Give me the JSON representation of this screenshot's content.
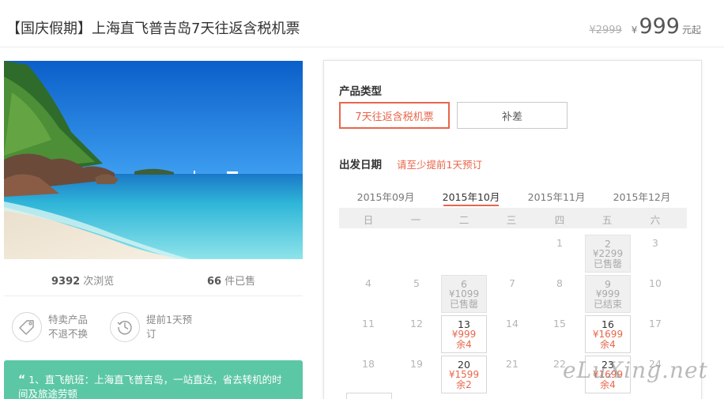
{
  "header": {
    "title": "【国庆假期】上海直飞普吉岛7天往返含税机票",
    "old_price": "¥2999",
    "currency": "¥",
    "price": "999",
    "price_suffix": "元起"
  },
  "stats": {
    "views_num": "9392",
    "views_label": "次浏览",
    "sold_num": "66",
    "sold_label": "件已售"
  },
  "features": [
    {
      "icon": "tag-icon",
      "text": "特卖产品 不退不换"
    },
    {
      "icon": "clock-icon",
      "text": "提前1天预订"
    }
  ],
  "description": {
    "quote": "“",
    "text": "1、直飞航班：上海直飞普吉岛，一站直达，省去转机的时间及旅途劳顿"
  },
  "panel": {
    "type_label": "产品类型",
    "types": [
      "7天往返含税机票",
      "补差"
    ],
    "date_label": "出发日期",
    "date_tip": "请至少提前1天预订",
    "months": [
      "2015年09月",
      "2015年10月",
      "2015年11月",
      "2015年12月"
    ],
    "active_month": "2015年10月",
    "weekdays": [
      "日",
      "一",
      "二",
      "三",
      "四",
      "五",
      "六"
    ],
    "calendar": [
      {
        "day": "1",
        "state": "plain"
      },
      {
        "day": "2",
        "state": "soldout",
        "price": "¥2299",
        "status": "已售罄"
      },
      {
        "day": "3",
        "state": "plain"
      },
      {
        "day": "4",
        "state": "plain"
      },
      {
        "day": "5",
        "state": "plain"
      },
      {
        "day": "6",
        "state": "soldout",
        "price": "¥1099",
        "status": "已售罄"
      },
      {
        "day": "7",
        "state": "plain"
      },
      {
        "day": "8",
        "state": "plain"
      },
      {
        "day": "9",
        "state": "soldout",
        "price": "¥999",
        "status": "已结束"
      },
      {
        "day": "10",
        "state": "plain"
      },
      {
        "day": "11",
        "state": "plain"
      },
      {
        "day": "12",
        "state": "plain"
      },
      {
        "day": "13",
        "state": "avail",
        "price": "¥999",
        "status": "余4"
      },
      {
        "day": "14",
        "state": "plain"
      },
      {
        "day": "15",
        "state": "plain"
      },
      {
        "day": "16",
        "state": "avail",
        "price": "¥1699",
        "status": "余4"
      },
      {
        "day": "17",
        "state": "plain"
      },
      {
        "day": "18",
        "state": "plain"
      },
      {
        "day": "19",
        "state": "plain"
      },
      {
        "day": "20",
        "state": "avail",
        "price": "¥1599",
        "status": "余2"
      },
      {
        "day": "21",
        "state": "plain"
      },
      {
        "day": "22",
        "state": "plain"
      },
      {
        "day": "23",
        "state": "avail",
        "price": "¥1699",
        "status": "余4"
      },
      {
        "day": "24",
        "state": "plain"
      }
    ]
  },
  "watermark": "eLuXing.net",
  "colors": {
    "accent": "#e8664b",
    "desc_bg": "#5cc7a4"
  }
}
